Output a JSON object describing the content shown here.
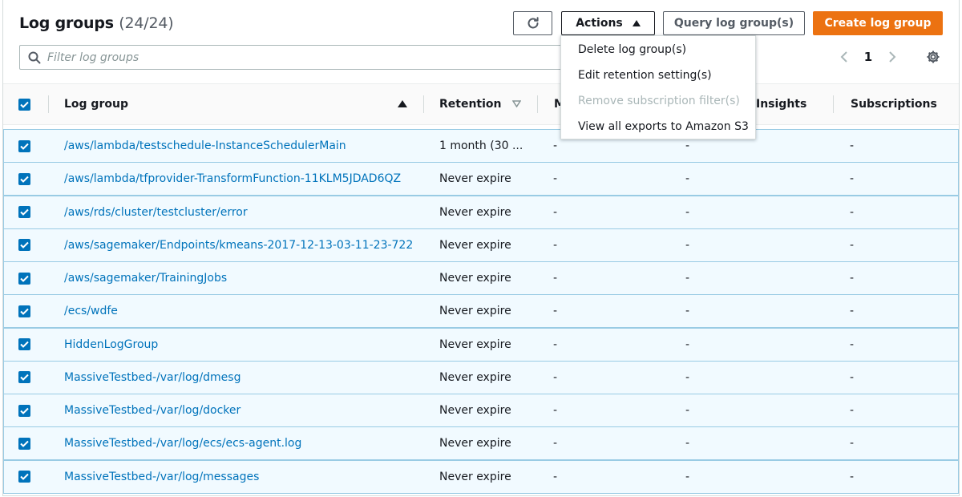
{
  "header": {
    "title": "Log groups",
    "count": "(24/24)",
    "refresh_icon": "refresh-icon",
    "actions_label": "Actions",
    "query_label": "Query log group(s)",
    "create_label": "Create log group"
  },
  "filter": {
    "placeholder": "Filter log groups",
    "value": ""
  },
  "pagination": {
    "current_page": "1"
  },
  "columns": {
    "log_group": "Log group",
    "retention": "Retention",
    "metric_filters": "M",
    "insights": "Insights",
    "subscriptions": "Subscriptions"
  },
  "actions_menu": [
    {
      "label": "Delete log group(s)",
      "enabled": true
    },
    {
      "label": "Edit retention setting(s)",
      "enabled": true
    },
    {
      "label": "Remove subscription filter(s)",
      "enabled": false
    },
    {
      "label": "View all exports to Amazon S3",
      "enabled": true
    }
  ],
  "rows": [
    {
      "name": "/aws/lambda/testschedule-InstanceSchedulerMain",
      "retention": "1 month (30 ...",
      "metric": "-",
      "insights": "-",
      "subscriptions": "-",
      "checked": true
    },
    {
      "name": "/aws/lambda/tfprovider-TransformFunction-11KLM5JDAD6QZ",
      "retention": "Never expire",
      "metric": "-",
      "insights": "-",
      "subscriptions": "-",
      "checked": true
    },
    {
      "name": "/aws/rds/cluster/testcluster/error",
      "retention": "Never expire",
      "metric": "-",
      "insights": "-",
      "subscriptions": "-",
      "checked": true
    },
    {
      "name": "/aws/sagemaker/Endpoints/kmeans-2017-12-13-03-11-23-722",
      "retention": "Never expire",
      "metric": "-",
      "insights": "-",
      "subscriptions": "-",
      "checked": true
    },
    {
      "name": "/aws/sagemaker/TrainingJobs",
      "retention": "Never expire",
      "metric": "-",
      "insights": "-",
      "subscriptions": "-",
      "checked": true
    },
    {
      "name": "/ecs/wdfe",
      "retention": "Never expire",
      "metric": "-",
      "insights": "-",
      "subscriptions": "-",
      "checked": true
    },
    {
      "name": "HiddenLogGroup",
      "retention": "Never expire",
      "metric": "-",
      "insights": "-",
      "subscriptions": "-",
      "checked": true
    },
    {
      "name": "MassiveTestbed-/var/log/dmesg",
      "retention": "Never expire",
      "metric": "-",
      "insights": "-",
      "subscriptions": "-",
      "checked": true
    },
    {
      "name": "MassiveTestbed-/var/log/docker",
      "retention": "Never expire",
      "metric": "-",
      "insights": "-",
      "subscriptions": "-",
      "checked": true
    },
    {
      "name": "MassiveTestbed-/var/log/ecs/ecs-agent.log",
      "retention": "Never expire",
      "metric": "-",
      "insights": "-",
      "subscriptions": "-",
      "checked": true
    },
    {
      "name": "MassiveTestbed-/var/log/messages",
      "retention": "Never expire",
      "metric": "-",
      "insights": "-",
      "subscriptions": "-",
      "checked": true
    }
  ],
  "colors": {
    "link": "#0073bb",
    "primary_button": "#ec7211",
    "selected_row_bg": "#f1faff",
    "selected_row_border": "#99cbe4",
    "checkbox": "#0073bb"
  }
}
